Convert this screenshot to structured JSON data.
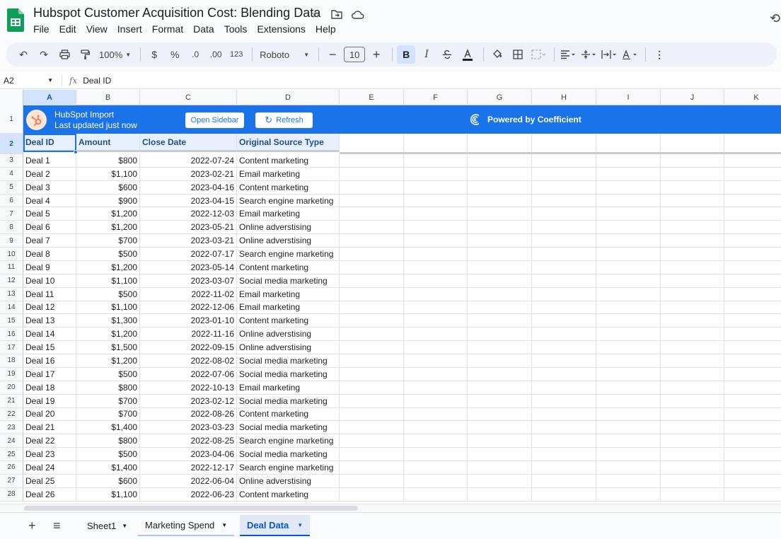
{
  "doc": {
    "title": "Hubspot Customer Acquisition Cost: Blending Data",
    "menu": [
      "File",
      "Edit",
      "View",
      "Insert",
      "Format",
      "Data",
      "Tools",
      "Extensions",
      "Help"
    ]
  },
  "toolbar": {
    "zoom": "100%",
    "currency": "$",
    "percent": "%",
    "dec_decrease": ".0",
    "dec_increase": ".00",
    "number_format": "123",
    "font": "Roboto",
    "font_size": "10",
    "minus": "−",
    "plus": "+",
    "bold": "B",
    "italic": "I"
  },
  "formula_bar": {
    "cell_ref": "A2",
    "fx": "fx",
    "content": "Deal ID"
  },
  "columns": [
    "A",
    "B",
    "C",
    "D",
    "E",
    "F",
    "G",
    "H",
    "I",
    "J",
    "K"
  ],
  "banner": {
    "title": "HubSpot Import",
    "subtitle": "Last updated just now",
    "open_sidebar": "Open Sidebar",
    "refresh": "Refresh",
    "powered_by": "Powered by Coefficient"
  },
  "headers": [
    "Deal ID",
    "Amount",
    "Close Date",
    "Original Source Type"
  ],
  "rows": [
    [
      "Deal 1",
      "$800",
      "2022-07-24",
      "Content marketing"
    ],
    [
      "Deal 2",
      "$1,100",
      "2023-02-21",
      "Email marketing"
    ],
    [
      "Deal 3",
      "$600",
      "2023-04-16",
      "Content marketing"
    ],
    [
      "Deal 4",
      "$900",
      "2023-04-15",
      "Search engine marketing"
    ],
    [
      "Deal 5",
      "$1,200",
      "2022-12-03",
      "Email marketing"
    ],
    [
      "Deal 6",
      "$1,200",
      "2023-05-21",
      "Online adverstising"
    ],
    [
      "Deal 7",
      "$700",
      "2023-03-21",
      "Online adverstising"
    ],
    [
      "Deal 8",
      "$500",
      "2022-07-17",
      "Search engine marketing"
    ],
    [
      "Deal 9",
      "$1,200",
      "2023-05-14",
      "Content marketing"
    ],
    [
      "Deal 10",
      "$1,100",
      "2023-03-07",
      "Social media marketing"
    ],
    [
      "Deal 11",
      "$500",
      "2022-11-02",
      "Email marketing"
    ],
    [
      "Deal 12",
      "$1,100",
      "2022-12-06",
      "Email marketing"
    ],
    [
      "Deal 13",
      "$1,300",
      "2023-01-10",
      "Content marketing"
    ],
    [
      "Deal 14",
      "$1,200",
      "2022-11-16",
      "Online adverstising"
    ],
    [
      "Deal 15",
      "$1,500",
      "2022-09-15",
      "Online adverstising"
    ],
    [
      "Deal 16",
      "$1,200",
      "2022-08-02",
      "Social media marketing"
    ],
    [
      "Deal 17",
      "$500",
      "2022-07-06",
      "Social media marketing"
    ],
    [
      "Deal 18",
      "$800",
      "2022-10-13",
      "Email marketing"
    ],
    [
      "Deal 19",
      "$700",
      "2023-02-12",
      "Social media marketing"
    ],
    [
      "Deal 20",
      "$700",
      "2022-08-26",
      "Content marketing"
    ],
    [
      "Deal 21",
      "$1,400",
      "2023-03-23",
      "Social media marketing"
    ],
    [
      "Deal 22",
      "$800",
      "2022-08-25",
      "Search engine marketing"
    ],
    [
      "Deal 23",
      "$500",
      "2023-04-06",
      "Social media marketing"
    ],
    [
      "Deal 24",
      "$1,400",
      "2022-12-17",
      "Search engine marketing"
    ],
    [
      "Deal 25",
      "$600",
      "2022-06-04",
      "Online adverstising"
    ],
    [
      "Deal 26",
      "$1,100",
      "2022-06-23",
      "Content marketing"
    ]
  ],
  "sheets": [
    "Sheet1",
    "Marketing Spend",
    "Deal Data"
  ],
  "active_sheet": "Deal Data",
  "colors": {
    "accent": "#1a73e8",
    "header_fill": "#e8f0fe",
    "toolbar": "#edf2fa"
  }
}
